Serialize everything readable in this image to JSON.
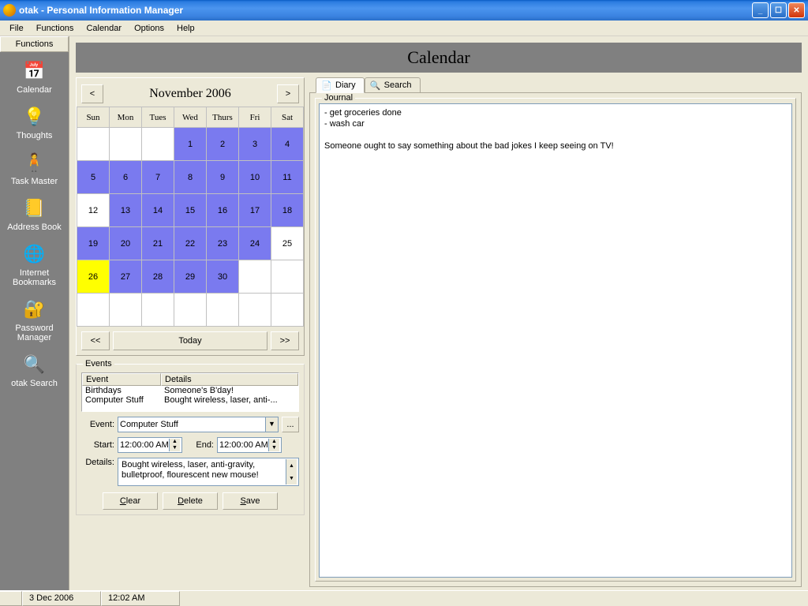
{
  "window": {
    "title": "otak - Personal Information Manager"
  },
  "menu": [
    "File",
    "Functions",
    "Calendar",
    "Options",
    "Help"
  ],
  "sidebar_header": "Functions",
  "sidebar": [
    {
      "label": "Calendar",
      "icon": "📅"
    },
    {
      "label": "Thoughts",
      "icon": "💡"
    },
    {
      "label": "Task Master",
      "icon": "🧍"
    },
    {
      "label": "Address Book",
      "icon": "📒"
    },
    {
      "label": "Internet Bookmarks",
      "icon": "🌐"
    },
    {
      "label": "Password Manager",
      "icon": "🔐"
    },
    {
      "label": "otak Search",
      "icon": "🔍"
    }
  ],
  "banner": "Calendar",
  "calendar": {
    "prev": "<",
    "next": ">",
    "title": "November 2006",
    "days": [
      "Sun",
      "Mon",
      "Tues",
      "Wed",
      "Thurs",
      "Fri",
      "Sat"
    ],
    "weeks": [
      [
        {
          "n": "",
          "c": "empty"
        },
        {
          "n": "",
          "c": "empty"
        },
        {
          "n": "",
          "c": "empty"
        },
        {
          "n": "1",
          "c": "fill"
        },
        {
          "n": "2",
          "c": "fill"
        },
        {
          "n": "3",
          "c": "fill"
        },
        {
          "n": "4",
          "c": "fill"
        }
      ],
      [
        {
          "n": "5",
          "c": "fill"
        },
        {
          "n": "6",
          "c": "fill"
        },
        {
          "n": "7",
          "c": "fill"
        },
        {
          "n": "8",
          "c": "fill"
        },
        {
          "n": "9",
          "c": "fill"
        },
        {
          "n": "10",
          "c": "fill"
        },
        {
          "n": "11",
          "c": "fill"
        }
      ],
      [
        {
          "n": "12",
          "c": "empty"
        },
        {
          "n": "13",
          "c": "fill"
        },
        {
          "n": "14",
          "c": "fill"
        },
        {
          "n": "15",
          "c": "fill"
        },
        {
          "n": "16",
          "c": "fill"
        },
        {
          "n": "17",
          "c": "fill"
        },
        {
          "n": "18",
          "c": "fill"
        }
      ],
      [
        {
          "n": "19",
          "c": "fill"
        },
        {
          "n": "20",
          "c": "fill"
        },
        {
          "n": "21",
          "c": "fill"
        },
        {
          "n": "22",
          "c": "fill"
        },
        {
          "n": "23",
          "c": "fill"
        },
        {
          "n": "24",
          "c": "fill"
        },
        {
          "n": "25",
          "c": "empty"
        }
      ],
      [
        {
          "n": "26",
          "c": "today"
        },
        {
          "n": "27",
          "c": "fill"
        },
        {
          "n": "28",
          "c": "fill"
        },
        {
          "n": "29",
          "c": "fill"
        },
        {
          "n": "30",
          "c": "fill"
        },
        {
          "n": "",
          "c": "empty"
        },
        {
          "n": "",
          "c": "empty"
        }
      ],
      [
        {
          "n": "",
          "c": "empty"
        },
        {
          "n": "",
          "c": "empty"
        },
        {
          "n": "",
          "c": "empty"
        },
        {
          "n": "",
          "c": "empty"
        },
        {
          "n": "",
          "c": "empty"
        },
        {
          "n": "",
          "c": "empty"
        },
        {
          "n": "",
          "c": "empty"
        }
      ]
    ],
    "dprev": "<<",
    "dnext": ">>",
    "today": "Today"
  },
  "events": {
    "legend": "Events",
    "col1": "Event",
    "col2": "Details",
    "rows": [
      {
        "event": "Birthdays",
        "details": "Someone's B'day!"
      },
      {
        "event": "Computer Stuff",
        "details": "Bought wireless, laser, anti-..."
      }
    ],
    "event_label": "Event:",
    "event_value": "Computer Stuff",
    "more": "...",
    "start_label": "Start:",
    "start_value": "12:00:00 AM",
    "end_label": "End:",
    "end_value": "12:00:00 AM",
    "details_label": "Details:",
    "details_value": "Bought wireless, laser, anti-gravity, bulletproof, flourescent new mouse!",
    "clear": "Clear",
    "delete": "Delete",
    "save": "Save"
  },
  "tabs": {
    "diary": "Diary",
    "search": "Search"
  },
  "journal": {
    "legend": "Journal",
    "text": "- get groceries done\n- wash car\n\nSomeone ought to say something about the bad jokes I keep seeing on TV!"
  },
  "status": {
    "date": "3 Dec 2006",
    "time": "12:02 AM"
  }
}
